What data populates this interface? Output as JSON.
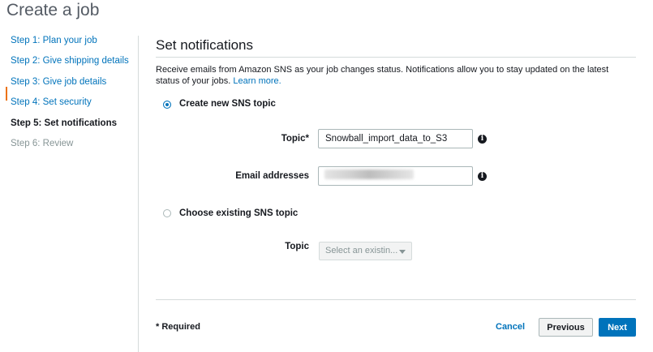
{
  "page": {
    "title": "Create a job"
  },
  "steps": [
    {
      "label": "Step 1: Plan your job",
      "state": "link"
    },
    {
      "label": "Step 2: Give shipping details",
      "state": "link"
    },
    {
      "label": "Step 3: Give job details",
      "state": "link"
    },
    {
      "label": "Step 4: Set security",
      "state": "link"
    },
    {
      "label": "Step 5: Set notifications",
      "state": "active"
    },
    {
      "label": "Step 6: Review",
      "state": "disabled"
    }
  ],
  "section": {
    "title": "Set notifications",
    "description": "Receive emails from Amazon SNS as your job changes status. Notifications allow you to stay updated on the latest status of your jobs. ",
    "learn_more": "Learn more."
  },
  "create_option": {
    "label": "Create new SNS topic",
    "selected": true,
    "topic_label": "Topic*",
    "topic_value": "Snowball_import_data_to_S3",
    "email_label": "Email addresses",
    "email_value": ""
  },
  "existing_option": {
    "label": "Choose existing SNS topic",
    "selected": false,
    "topic_label": "Topic",
    "select_placeholder": "Select an existin..."
  },
  "footer": {
    "required_note": "* Required",
    "cancel_label": "Cancel",
    "previous_label": "Previous",
    "next_label": "Next"
  },
  "icons": {
    "info": "info-icon",
    "caret": "caret-down-icon"
  },
  "colors": {
    "link": "#0073bb",
    "active_marker": "#ec7211",
    "primary_button": "#0073bb"
  }
}
